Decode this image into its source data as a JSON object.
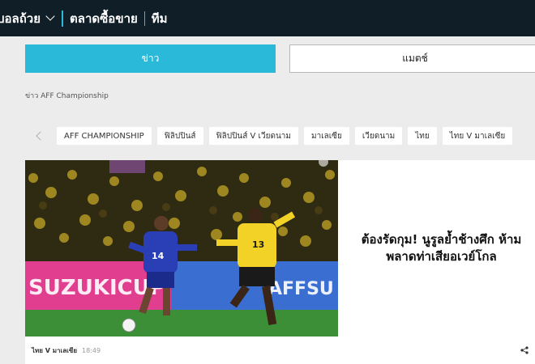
{
  "nav": {
    "items": [
      {
        "label": "บอลถ้วย"
      },
      {
        "label": "ตลาดซื้อขาย"
      },
      {
        "label": "ทีม"
      }
    ]
  },
  "tabs": {
    "news_label": "ข่าว",
    "match_label": "แมตช์"
  },
  "breadcrumb": "ข่าว AFF Championship",
  "chips": [
    "AFF CHAMPIONSHIP",
    "ฟิลิปปินส์",
    "ฟิลิปปินส์ V เวียดนาม",
    "มาเลเซีย",
    "เวียดนาม",
    "ไทย",
    "ไทย V มาเลเซีย"
  ],
  "article": {
    "headline": "ต้องรัดกุม! นูรูลย้ำช้างศึก ห้ามพลาดท่าเสียอเวย์โกล",
    "tag": "ไทย V มาเลเซีย",
    "time": "18:49",
    "photo_banner_left": "SUZUKICUP",
    "photo_banner_right": "AFFSU",
    "player_left_number": "14",
    "player_right_number": "13"
  },
  "colors": {
    "topbar": "#101e27",
    "accent": "#2ab9d8",
    "page_bg": "#ececec"
  },
  "icons": {
    "dropdown": "chevron-down-icon",
    "carousel_prev": "chevron-left-icon",
    "share": "share-icon"
  }
}
